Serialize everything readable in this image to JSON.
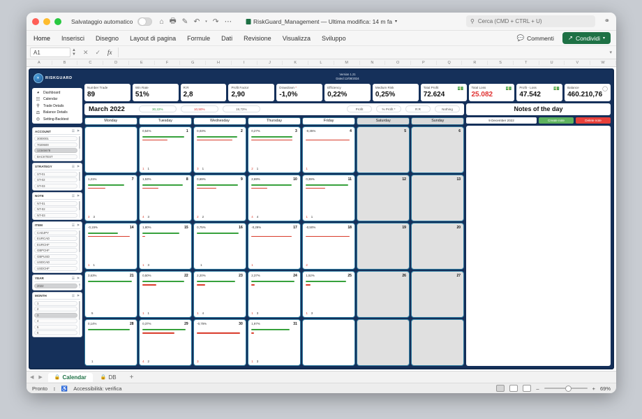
{
  "titlebar": {
    "autosave_label": "Salvataggio automatico",
    "doc_title": "RiskGuard_Management — Ultima modifica: 14 m fa",
    "search_placeholder": "Cerca (CMD + CTRL + U)",
    "icons": [
      "home-icon",
      "print-icon",
      "edit-icon",
      "undo-icon",
      "redo-icon",
      "more-icon"
    ]
  },
  "ribbon": {
    "tabs": [
      {
        "label": "Home"
      },
      {
        "label": "Inserisci"
      },
      {
        "label": "Disegno"
      },
      {
        "label": "Layout di pagina"
      },
      {
        "label": "Formule"
      },
      {
        "label": "Dati"
      },
      {
        "label": "Revisione"
      },
      {
        "label": "Visualizza"
      },
      {
        "label": "Sviluppo"
      }
    ],
    "comments_label": "Commenti",
    "share_label": "Condividi"
  },
  "formulabar": {
    "namebox": "A1",
    "fx_label": "fx",
    "formula_value": ""
  },
  "column_headers": [
    "A",
    "B",
    "C",
    "D",
    "E",
    "F",
    "G",
    "H",
    "I",
    "J",
    "K",
    "L",
    "M",
    "N",
    "O",
    "P",
    "Q",
    "R",
    "S",
    "T",
    "U",
    "V",
    "W"
  ],
  "app": {
    "brand": "RISKGUARD",
    "version_line1": "Version 1.21",
    "version_line2": "Dated 12/08/2024",
    "nav": [
      {
        "label": "Dashboard",
        "icon": "pie-chart-icon"
      },
      {
        "label": "Calendar",
        "icon": "calendar-icon"
      },
      {
        "label": "Trade Details",
        "icon": "search-icon"
      },
      {
        "label": "Balance Details",
        "icon": "scale-icon"
      },
      {
        "label": "Setting-Backtest",
        "icon": "gear-icon"
      }
    ],
    "filters": [
      {
        "title": "ACCOUNT",
        "items": [
          {
            "label": "3000001",
            "selected": false
          },
          {
            "label": "7020600",
            "selected": false
          },
          {
            "label": "12345678",
            "selected": true
          },
          {
            "label": "BACKTEST",
            "selected": false
          }
        ]
      },
      {
        "title": "STRATEGY",
        "items": [
          {
            "label": "ST-01",
            "selected": false
          },
          {
            "label": "ST-02",
            "selected": false
          },
          {
            "label": "ST-03",
            "selected": false
          }
        ]
      },
      {
        "title": "NOTE",
        "items": [
          {
            "label": "NT-01",
            "selected": false
          },
          {
            "label": "NT-02",
            "selected": false
          },
          {
            "label": "NT-03",
            "selected": false
          }
        ]
      },
      {
        "title": "ITEM",
        "items": [
          {
            "label": "CADJPY",
            "selected": false
          },
          {
            "label": "EURCAD",
            "selected": false
          },
          {
            "label": "EURCHF",
            "selected": false
          },
          {
            "label": "GBPCHF",
            "selected": false
          },
          {
            "label": "GBPUSD",
            "selected": false
          },
          {
            "label": "USDCAD",
            "selected": false
          },
          {
            "label": "USDCHF",
            "selected": false
          }
        ]
      },
      {
        "title": "YEAR",
        "items": [
          {
            "label": "2022",
            "selected": true
          }
        ]
      },
      {
        "title": "MONTH",
        "items": [
          {
            "label": "1",
            "selected": false
          },
          {
            "label": "2",
            "selected": false
          },
          {
            "label": "3",
            "selected": true
          },
          {
            "label": "4",
            "selected": false
          },
          {
            "label": "5",
            "selected": false
          },
          {
            "label": "6",
            "selected": false
          }
        ]
      }
    ],
    "kpis": [
      {
        "label": "Number Trade",
        "value": "89",
        "style": "normal",
        "icon": ""
      },
      {
        "label": "Win Rate",
        "value": "51%",
        "style": "normal",
        "icon": ""
      },
      {
        "label": "R:R",
        "value": "2,8",
        "style": "normal",
        "icon": ""
      },
      {
        "label": "Profit Factor",
        "value": "2,90",
        "style": "normal",
        "icon": ""
      },
      {
        "label": "Drawdown",
        "value": "-1,0%",
        "style": "normal",
        "icon": "",
        "star": "*"
      },
      {
        "label": "Efficiency",
        "value": "0,22%",
        "style": "normal",
        "icon": ""
      },
      {
        "label": "Medium Risk",
        "value": "0,25%",
        "style": "normal",
        "icon": ""
      },
      {
        "label": "Total Profit",
        "value": "72.624",
        "style": "normal",
        "icon": "money-icon"
      },
      {
        "label": "Total Loss",
        "value": "25.082",
        "style": "red",
        "icon": "money-icon"
      },
      {
        "label": "Profit - Loss",
        "value": "47.542",
        "style": "normal",
        "icon": "money-icon"
      },
      {
        "label": "Balance",
        "value": "460.210,76",
        "style": "normal",
        "icon": "piggy-bank-icon"
      }
    ],
    "month_title": "March 2022",
    "month_pills": [
      {
        "label": "30,22%",
        "style": "green"
      },
      {
        "label": "10,50%",
        "style": "red"
      },
      {
        "label": "19,72%",
        "style": "plain"
      }
    ],
    "toggle_pills": [
      {
        "label": "Profit"
      },
      {
        "label": "% Profit *"
      },
      {
        "label": "R:R"
      },
      {
        "label": "Nothing"
      }
    ],
    "notes": {
      "title": "Notes of the day",
      "date": "9 December 2022",
      "create_label": "Create note",
      "delete_label": "Delete note",
      "body": ""
    },
    "daynames": [
      "Monday",
      "Tuesday",
      "Wednesday",
      "Thursday",
      "Friday",
      "Saturday",
      "Sunday"
    ],
    "weeks": [
      [
        {
          "day": "",
          "empty": true
        },
        {
          "day": "1",
          "pct": "0,54%",
          "green": 92,
          "red": 55,
          "wins": "1",
          "losses": "1"
        },
        {
          "day": "2",
          "pct": "0,03%",
          "green": 88,
          "red": 78,
          "wins": "3",
          "losses": "1"
        },
        {
          "day": "3",
          "pct": "0,27%",
          "green": 90,
          "red": 90,
          "wins": "2",
          "losses": "1"
        },
        {
          "day": "4",
          "pct": "-0,35%",
          "green": 0,
          "red": 96,
          "wins": "1",
          "losses": ""
        },
        {
          "day": "5",
          "weekend": true
        },
        {
          "day": "6",
          "weekend": true
        }
      ],
      [
        {
          "day": "7",
          "pct": "1,21%",
          "green": 80,
          "red": 38,
          "wins": "3",
          "losses": "3"
        },
        {
          "day": "8",
          "pct": "1,53%",
          "green": 88,
          "red": 35,
          "wins": "4",
          "losses": "3"
        },
        {
          "day": "9",
          "pct": "0,69%",
          "green": 90,
          "red": 42,
          "wins": "2",
          "losses": "2"
        },
        {
          "day": "10",
          "pct": "2,69%",
          "green": 88,
          "red": 34,
          "wins": "4",
          "losses": "4"
        },
        {
          "day": "11",
          "pct": "0,39%",
          "green": 92,
          "red": 42,
          "wins": "1",
          "losses": "1"
        },
        {
          "day": "12",
          "weekend": true
        },
        {
          "day": "13",
          "weekend": true
        }
      ],
      [
        {
          "day": "14",
          "pct": "-0,15%",
          "green": 66,
          "red": 92,
          "wins": "1",
          "losses": "1"
        },
        {
          "day": "15",
          "pct": "1,80%",
          "green": 80,
          "red": 6,
          "wins": "1",
          "losses": "3"
        },
        {
          "day": "16",
          "pct": "0,75%",
          "green": 92,
          "red": 0,
          "wins": "",
          "losses": "1"
        },
        {
          "day": "17",
          "pct": "-0,29%",
          "green": 0,
          "red": 88,
          "wins": "1",
          "losses": ""
        },
        {
          "day": "18",
          "pct": "-0,50%",
          "green": 0,
          "red": 96,
          "wins": "2",
          "losses": ""
        },
        {
          "day": "19",
          "weekend": true
        },
        {
          "day": "20",
          "weekend": true
        }
      ],
      [
        {
          "day": "21",
          "pct": "3,63%",
          "green": 96,
          "red": 0,
          "wins": "",
          "losses": "5"
        },
        {
          "day": "22",
          "pct": "0,50%",
          "green": 92,
          "red": 30,
          "wins": "1",
          "losses": "1"
        },
        {
          "day": "23",
          "pct": "2,20%",
          "green": 84,
          "red": 18,
          "wins": "1",
          "losses": "4"
        },
        {
          "day": "24",
          "pct": "2,37%",
          "green": 94,
          "red": 8,
          "wins": "1",
          "losses": "3"
        },
        {
          "day": "25",
          "pct": "1,52%",
          "green": 88,
          "red": 10,
          "wins": "1",
          "losses": "3"
        },
        {
          "day": "26",
          "weekend": true
        },
        {
          "day": "27",
          "weekend": true
        }
      ],
      [
        {
          "day": "28",
          "pct": "0,14%",
          "green": 92,
          "red": 0,
          "wins": "",
          "losses": "1"
        },
        {
          "day": "29",
          "pct": "0,37%",
          "green": 94,
          "red": 70,
          "wins": "4",
          "losses": "2"
        },
        {
          "day": "30",
          "pct": "-0,75%",
          "green": 0,
          "red": 94,
          "wins": "3",
          "losses": ""
        },
        {
          "day": "31",
          "pct": "1,97%",
          "green": 84,
          "red": 6,
          "wins": "1",
          "losses": "3"
        },
        {
          "day": "",
          "empty": true
        },
        {
          "day": "",
          "weekend": true
        },
        {
          "day": "",
          "weekend": true
        }
      ]
    ]
  },
  "sheettabs": {
    "tabs": [
      {
        "label": "Calendar",
        "active": true,
        "locked": true
      },
      {
        "label": "DB",
        "active": false,
        "locked": true
      }
    ],
    "add_label": "+"
  },
  "statusbar": {
    "status": "Pronto",
    "accessibility": "Accessibilità: verifica",
    "zoom": "69%"
  }
}
